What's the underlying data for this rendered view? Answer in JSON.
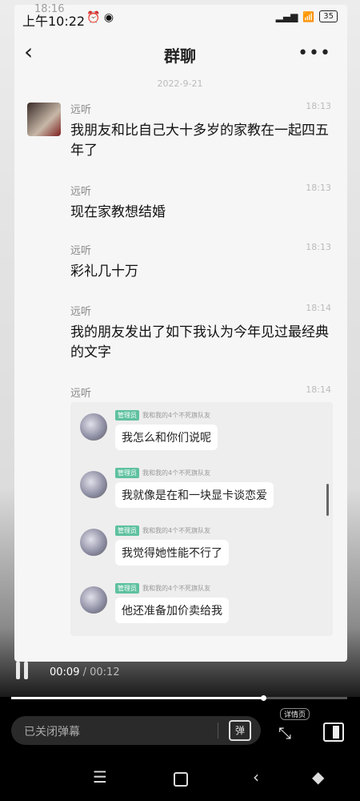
{
  "status_bar": {
    "time": "上午10:22",
    "time_overlay": "18:16",
    "battery": "35"
  },
  "header": {
    "title": "群聊",
    "more": "•••"
  },
  "date_divider": "2022-9-21",
  "messages": [
    {
      "sender": "远听",
      "time": "18:13",
      "text": "我朋友和比自己大十多岁的家教在一起四五年了"
    },
    {
      "sender": "远听",
      "time": "18:13",
      "text": "现在家教想结婚"
    },
    {
      "sender": "远听",
      "time": "18:13",
      "text": "彩礼几十万"
    },
    {
      "sender": "远听",
      "time": "18:14",
      "text": "我的朋友发出了如下我认为今年见过最经典的文字"
    },
    {
      "sender": "远听",
      "time": "18:14",
      "text": ""
    }
  ],
  "embedded_chat": {
    "badge": "管理员",
    "group": "我和我的4个不死旗队友",
    "messages": [
      "我怎么和你们说呢",
      "我就像是在和一块显卡谈恋爱",
      "我觉得她性能不行了",
      "他还准备加价卖给我"
    ]
  },
  "player": {
    "current": "00:09",
    "total": "/ 00:12",
    "progress": 0.75
  },
  "danmaku": {
    "placeholder": "已关闭弹幕",
    "icon_label": "弹"
  },
  "detail_label": "详情页",
  "icons": {
    "back": "back-chevron-icon",
    "more": "more-icon",
    "pause": "pause-icon",
    "danmaku": "danmaku-toggle-icon",
    "shrink": "exit-fullscreen-icon",
    "side": "side-view-icon"
  }
}
